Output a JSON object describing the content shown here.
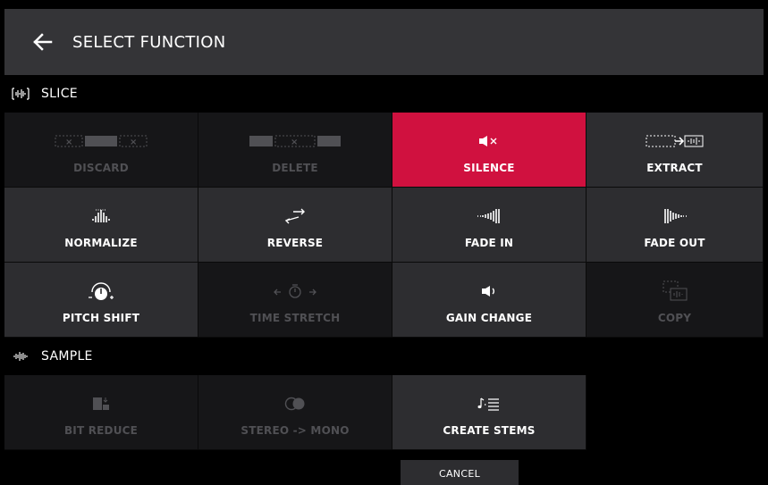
{
  "header": {
    "title": "SELECT FUNCTION",
    "back_icon": "arrow-left-icon"
  },
  "slice": {
    "label": "SLICE",
    "items": [
      {
        "label": "DISCARD",
        "icon": "discard-icon",
        "state": "disabled"
      },
      {
        "label": "DELETE",
        "icon": "delete-icon",
        "state": "disabled"
      },
      {
        "label": "SILENCE",
        "icon": "silence-icon",
        "state": "active"
      },
      {
        "label": "EXTRACT",
        "icon": "extract-icon",
        "state": "enabled"
      },
      {
        "label": "NORMALIZE",
        "icon": "normalize-icon",
        "state": "enabled"
      },
      {
        "label": "REVERSE",
        "icon": "reverse-icon",
        "state": "enabled"
      },
      {
        "label": "FADE IN",
        "icon": "fade-in-icon",
        "state": "enabled"
      },
      {
        "label": "FADE OUT",
        "icon": "fade-out-icon",
        "state": "enabled"
      },
      {
        "label": "PITCH SHIFT",
        "icon": "pitch-shift-icon",
        "state": "enabled"
      },
      {
        "label": "TIME STRETCH",
        "icon": "time-stretch-icon",
        "state": "disabled"
      },
      {
        "label": "GAIN CHANGE",
        "icon": "gain-change-icon",
        "state": "enabled"
      },
      {
        "label": "COPY",
        "icon": "copy-icon",
        "state": "disabled"
      }
    ]
  },
  "sample": {
    "label": "SAMPLE",
    "items": [
      {
        "label": "BIT REDUCE",
        "icon": "bit-reduce-icon",
        "state": "disabled"
      },
      {
        "label": "STEREO -> MONO",
        "icon": "stereo-mono-icon",
        "state": "disabled"
      },
      {
        "label": "CREATE STEMS",
        "icon": "create-stems-icon",
        "state": "enabled"
      }
    ]
  },
  "cancel_label": "CANCEL",
  "colors": {
    "accent": "#d0113f",
    "header": "#343437",
    "cell": "#2d2d30",
    "cell_disabled": "#161618"
  }
}
